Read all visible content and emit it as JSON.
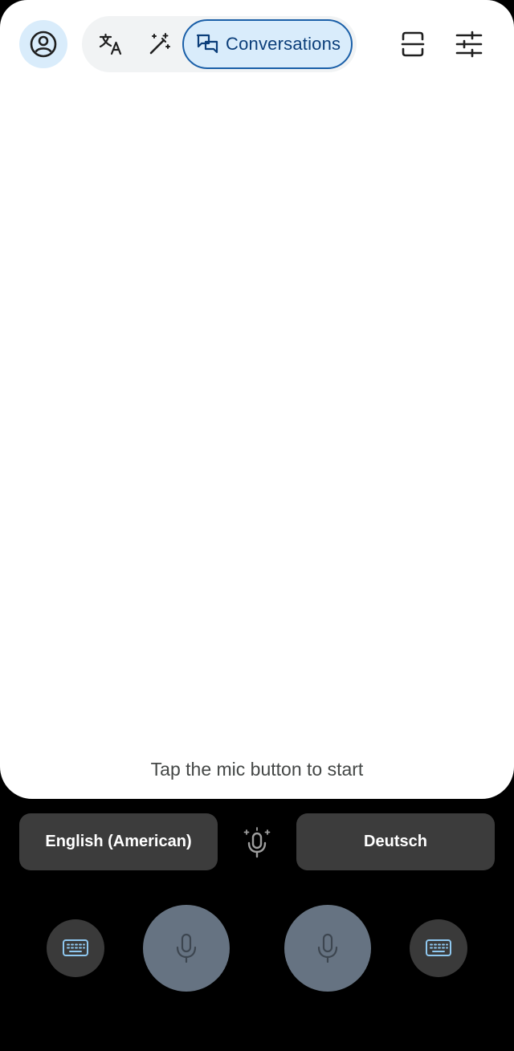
{
  "header": {
    "profile_icon": "account-circle-icon",
    "modes": [
      {
        "icon": "translate-icon",
        "active": false
      },
      {
        "icon": "magic-wand-icon",
        "active": false
      },
      {
        "icon": "conversation-icon",
        "label": "Conversations",
        "active": true
      }
    ],
    "right_icons": [
      "scan-frame-icon",
      "sliders-icon"
    ]
  },
  "main": {
    "hint": "Tap the mic button to start"
  },
  "languages": {
    "left": "English (American)",
    "right": "Deutsch",
    "swap_icon": "auto-mic-icon"
  },
  "controls": {
    "left_keyboard_icon": "keyboard-icon",
    "left_mic_icon": "mic-icon",
    "right_mic_icon": "mic-icon",
    "right_keyboard_icon": "keyboard-icon"
  },
  "colors": {
    "accent": "#1a5fa8",
    "accent_fill": "#d9ecfb",
    "mic_button": "#667382",
    "language_button": "#3c3c3c"
  }
}
